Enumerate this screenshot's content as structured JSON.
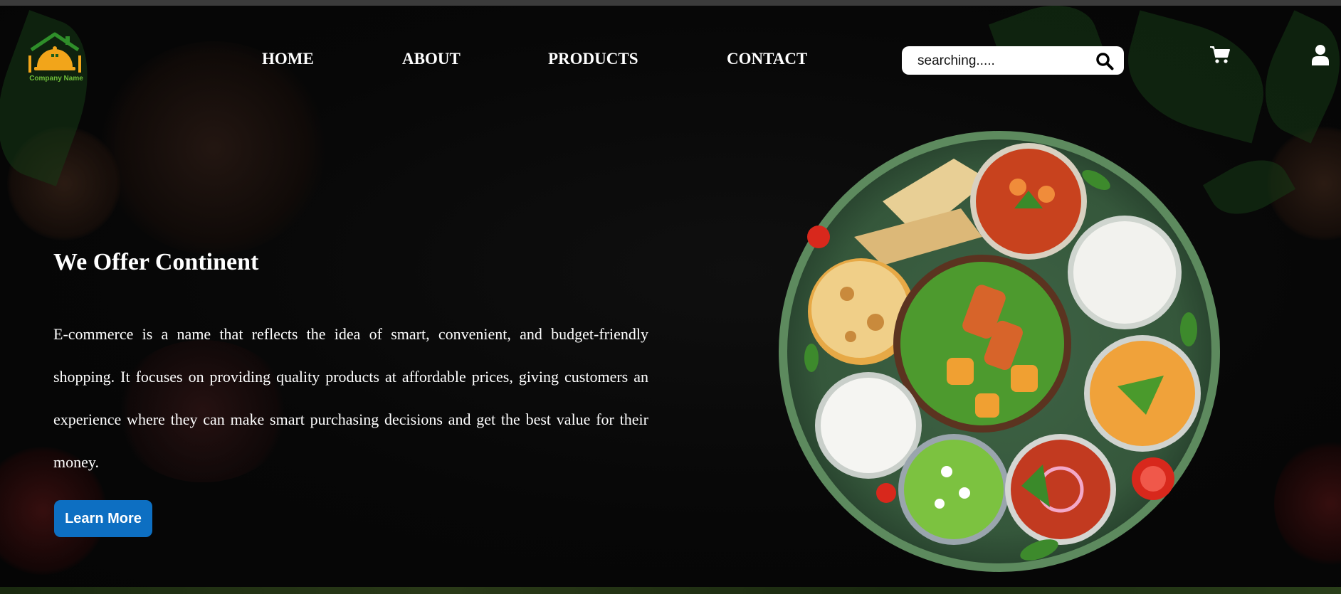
{
  "brand": {
    "logo_text": "Company Name"
  },
  "nav": {
    "items": [
      {
        "label": "HOME"
      },
      {
        "label": "ABOUT"
      },
      {
        "label": "PRODUCTS"
      },
      {
        "label": "CONTACT"
      }
    ]
  },
  "search": {
    "placeholder": "searching....."
  },
  "icons": {
    "search": "search-icon",
    "cart": "cart-icon",
    "user": "user-icon"
  },
  "hero": {
    "title": "We Offer Continent",
    "description": "E-commerce is a name that reflects the idea of smart, convenient, and budget-friendly shopping. It focuses on providing quality products at affordable prices, giving customers an experience where they can make smart purchasing decisions and get the best value for their money.",
    "button_label": "Learn More"
  },
  "colors": {
    "accent": "#0d6fc2",
    "background": "#060606",
    "text": "#ffffff"
  }
}
